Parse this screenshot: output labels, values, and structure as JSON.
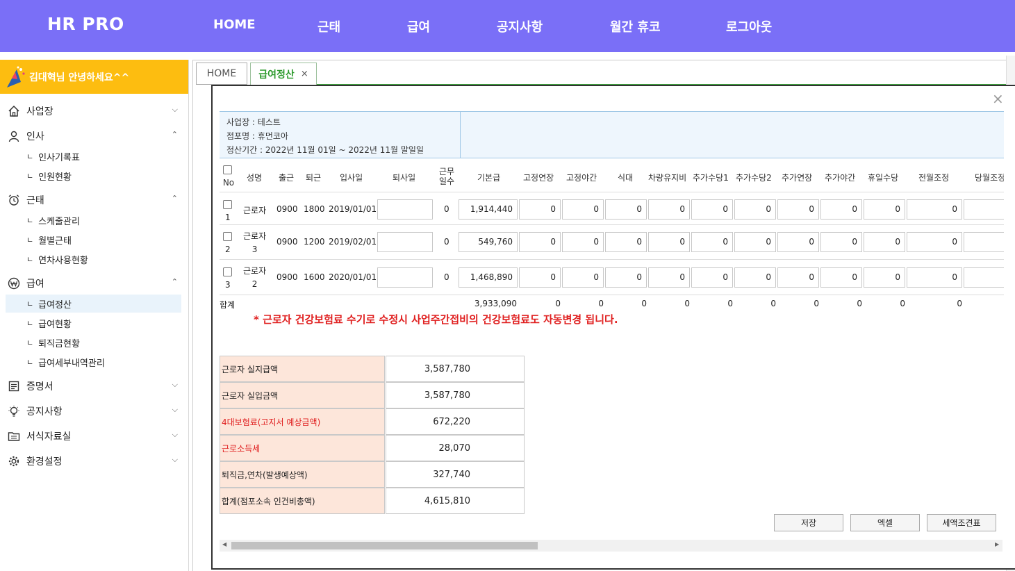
{
  "header": {
    "brand": "HR PRO",
    "nav": [
      "HOME",
      "근태",
      "급여",
      "공지사항",
      "월간 휴코",
      "로그아웃"
    ]
  },
  "sidebar": {
    "welcome": "김대혁님 안녕하세요^^",
    "menus": [
      {
        "label": "사업장",
        "icon": "home-icon",
        "expanded": false
      },
      {
        "label": "인사",
        "icon": "person-icon",
        "expanded": true,
        "items": [
          "인사기록표",
          "인원현황"
        ]
      },
      {
        "label": "근태",
        "icon": "alarm-clock-icon",
        "expanded": true,
        "items": [
          "스케줄관리",
          "월별근태",
          "연차사용현황"
        ]
      },
      {
        "label": "급여",
        "icon": "won-icon",
        "expanded": true,
        "items": [
          "급여정산",
          "급여현황",
          "퇴직금현황",
          "급여세부내역관리"
        ]
      },
      {
        "label": "증명서",
        "icon": "document-icon",
        "expanded": false
      },
      {
        "label": "공지사항",
        "icon": "lightbulb-icon",
        "expanded": false
      },
      {
        "label": "서식자료실",
        "icon": "folder-icon",
        "expanded": false
      },
      {
        "label": "환경설정",
        "icon": "gear-icon",
        "expanded": false
      }
    ]
  },
  "tabs": {
    "home": "HOME",
    "active": "급여정산",
    "close": "×"
  },
  "modal": {
    "close": "×",
    "info": {
      "site": "사업장 : 테스트",
      "store": "점포명 : 휴먼코아",
      "period": "정산기간 : 2022년 11월 01일 ~ 2022년 11월 말일일"
    },
    "columns": [
      "No",
      "성명",
      "출근",
      "퇴근",
      "입사일",
      "퇴사일",
      "근무\n일수",
      "기본급",
      "고정연장",
      "고정야간",
      "식대",
      "차량유지비",
      "추가수당1",
      "추가수당2",
      "추가연장",
      "추가야간",
      "휴일수당",
      "전월조정",
      "당월조정"
    ],
    "rows": [
      {
        "no": "1",
        "name": "근로자",
        "in": "0900",
        "out": "1800",
        "join": "2019/01/01",
        "leave": "",
        "days": "0",
        "base": "1,914,440",
        "vals": [
          "0",
          "0",
          "0",
          "0",
          "0",
          "0",
          "0",
          "0",
          "0",
          "0",
          ""
        ]
      },
      {
        "no": "2",
        "name": "근로자\n3",
        "in": "0900",
        "out": "1200",
        "join": "2019/02/01",
        "leave": "",
        "days": "0",
        "base": "549,760",
        "vals": [
          "0",
          "0",
          "0",
          "0",
          "0",
          "0",
          "0",
          "0",
          "0",
          "0",
          ""
        ]
      },
      {
        "no": "3",
        "name": "근로자\n2",
        "in": "0900",
        "out": "1600",
        "join": "2020/01/01",
        "leave": "",
        "days": "0",
        "base": "1,468,890",
        "vals": [
          "0",
          "0",
          "0",
          "0",
          "0",
          "0",
          "0",
          "0",
          "0",
          "0",
          ""
        ]
      }
    ],
    "total_label": "합계",
    "totals": {
      "base": "3,933,090",
      "vals": [
        "0",
        "0",
        "0",
        "0",
        "0",
        "0",
        "0",
        "0",
        "0",
        "0"
      ]
    },
    "notice": "* 근로자 건강보험료 수기로 수정시 사업주간접비의 건강보험료도 자동변경 됩니다.",
    "summary": [
      {
        "label": "근로자 실지급액",
        "value": "3,587,780",
        "red": false
      },
      {
        "label": "근로자 실입금액",
        "value": "3,587,780",
        "red": false
      },
      {
        "label": "4대보험료(고지서 예상금액)",
        "value": "672,220",
        "red": true
      },
      {
        "label": "근로소득세",
        "value": "28,070",
        "red": true
      },
      {
        "label": "퇴직금,연차(발생예상액)",
        "value": "327,740",
        "red": false
      },
      {
        "label": "합계(점포소속 인건비총액)",
        "value": "4,615,810",
        "red": false
      }
    ],
    "buttons": {
      "save": "저장",
      "excel": "엑셀",
      "tax": "세액조견표"
    }
  },
  "colors": {
    "topbar": "#7a6ff7",
    "welcome": "#fdbd10",
    "active_tab": "#2d9a2d",
    "notice": "#e02020",
    "summary_label_bg": "#fde6da"
  }
}
